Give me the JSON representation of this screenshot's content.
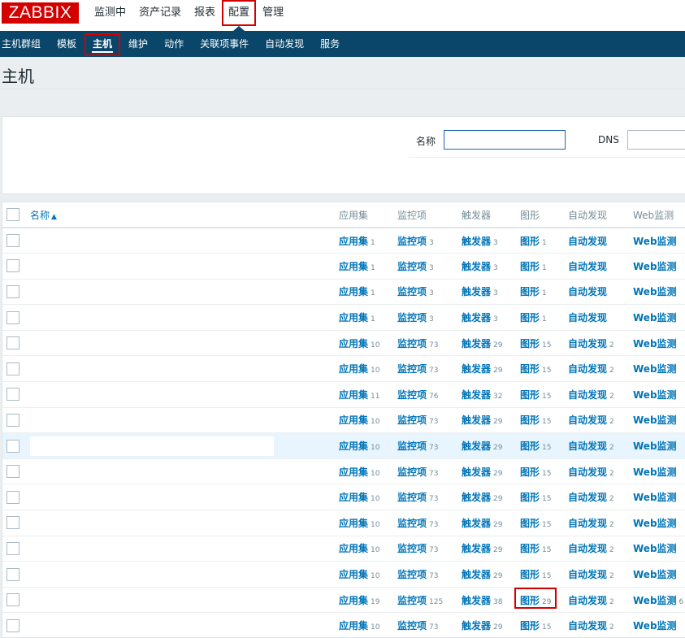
{
  "logo": "ZABBIX",
  "top_menu": [
    {
      "label": "监测中",
      "active": false
    },
    {
      "label": "资产记录",
      "active": false
    },
    {
      "label": "报表",
      "active": false
    },
    {
      "label": "配置",
      "active": true
    },
    {
      "label": "管理",
      "active": false
    }
  ],
  "sub_menu": [
    {
      "label": "主机群组",
      "active": false
    },
    {
      "label": "模板",
      "active": false
    },
    {
      "label": "主机",
      "active": true
    },
    {
      "label": "维护",
      "active": false
    },
    {
      "label": "动作",
      "active": false
    },
    {
      "label": "关联项事件",
      "active": false
    },
    {
      "label": "自动发现",
      "active": false
    },
    {
      "label": "服务",
      "active": false
    }
  ],
  "page_title": "主机",
  "filter": {
    "name_label": "名称",
    "name_value": "",
    "dns_label": "DNS",
    "dns_value": ""
  },
  "table": {
    "headers": {
      "name": "名称",
      "applications": "应用集",
      "items": "监控项",
      "triggers": "触发器",
      "graphs": "图形",
      "discovery": "自动发现",
      "web": "Web监测"
    },
    "link_labels": {
      "applications": "应用集",
      "items": "监控项",
      "triggers": "触发器",
      "graphs": "图形",
      "discovery": "自动发现",
      "web": "Web监测"
    },
    "rows": [
      {
        "applications": "1",
        "items": "3",
        "triggers": "3",
        "graphs": "1",
        "discovery": "",
        "web": "",
        "highlight": false
      },
      {
        "applications": "1",
        "items": "3",
        "triggers": "3",
        "graphs": "1",
        "discovery": "",
        "web": "",
        "highlight": false
      },
      {
        "applications": "1",
        "items": "3",
        "triggers": "3",
        "graphs": "1",
        "discovery": "",
        "web": "",
        "highlight": false
      },
      {
        "applications": "1",
        "items": "3",
        "triggers": "3",
        "graphs": "1",
        "discovery": "",
        "web": "",
        "highlight": false
      },
      {
        "applications": "10",
        "items": "73",
        "triggers": "29",
        "graphs": "15",
        "discovery": "2",
        "web": "",
        "highlight": false
      },
      {
        "applications": "10",
        "items": "73",
        "triggers": "29",
        "graphs": "15",
        "discovery": "2",
        "web": "",
        "highlight": false
      },
      {
        "applications": "11",
        "items": "76",
        "triggers": "32",
        "graphs": "15",
        "discovery": "2",
        "web": "",
        "highlight": false
      },
      {
        "applications": "10",
        "items": "73",
        "triggers": "29",
        "graphs": "15",
        "discovery": "2",
        "web": "",
        "highlight": false
      },
      {
        "applications": "10",
        "items": "73",
        "triggers": "29",
        "graphs": "15",
        "discovery": "2",
        "web": "",
        "highlight": true
      },
      {
        "applications": "10",
        "items": "73",
        "triggers": "29",
        "graphs": "15",
        "discovery": "2",
        "web": "",
        "highlight": false
      },
      {
        "applications": "10",
        "items": "73",
        "triggers": "29",
        "graphs": "15",
        "discovery": "2",
        "web": "",
        "highlight": false
      },
      {
        "applications": "10",
        "items": "73",
        "triggers": "29",
        "graphs": "15",
        "discovery": "2",
        "web": "",
        "highlight": false
      },
      {
        "applications": "10",
        "items": "73",
        "triggers": "29",
        "graphs": "15",
        "discovery": "2",
        "web": "",
        "highlight": false
      },
      {
        "applications": "10",
        "items": "73",
        "triggers": "29",
        "graphs": "15",
        "discovery": "2",
        "web": "",
        "highlight": false
      },
      {
        "applications": "19",
        "items": "125",
        "triggers": "38",
        "graphs": "29",
        "discovery": "2",
        "web": "6",
        "highlight": false
      },
      {
        "applications": "10",
        "items": "73",
        "triggers": "29",
        "graphs": "15",
        "discovery": "2",
        "web": "",
        "highlight": false
      }
    ]
  },
  "colors": {
    "brand": "#d40000",
    "subnav_bg": "#0a466a",
    "link": "#0275b8",
    "annotation": "#d40000"
  }
}
